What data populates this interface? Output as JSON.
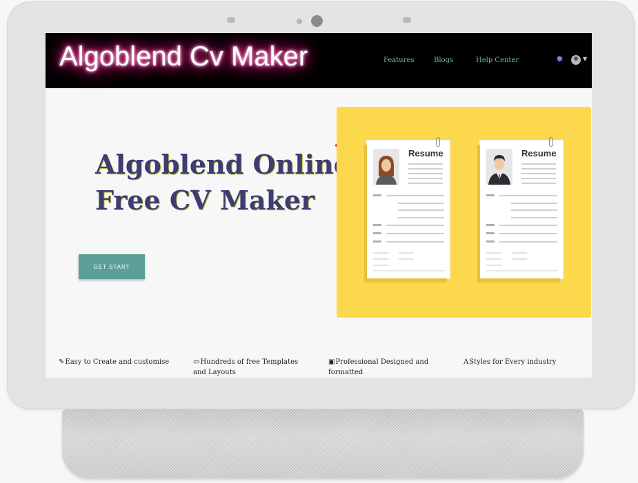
{
  "navbar": {
    "brand": "Algoblend Cv Maker",
    "links": [
      "Features",
      "Blogs",
      "Help Center"
    ],
    "settings_icon": "gear-icon",
    "user_icon": "avatar",
    "dropdown_icon": "caret-down-icon"
  },
  "hero": {
    "title_line1": "Algoblend Online",
    "title_line2": "Free CV Maker",
    "button_label": "GET START"
  },
  "illustration": {
    "card_title_left": "Resume",
    "card_title_right": "Resume",
    "background_color": "#fcd94c"
  },
  "features": [
    {
      "icon": "edit-icon",
      "label": "Easy to Create and customise"
    },
    {
      "icon": "monitor-icon",
      "label": "Hundreds of free Templates and Layouts"
    },
    {
      "icon": "image-icon",
      "label": "Professional Designed and formatted"
    },
    {
      "icon": "font-icon",
      "label": "Styles for Every industry"
    }
  ],
  "colors": {
    "accent": "#5c9f99",
    "navbar": "#000000",
    "title": "#3d3d73"
  }
}
